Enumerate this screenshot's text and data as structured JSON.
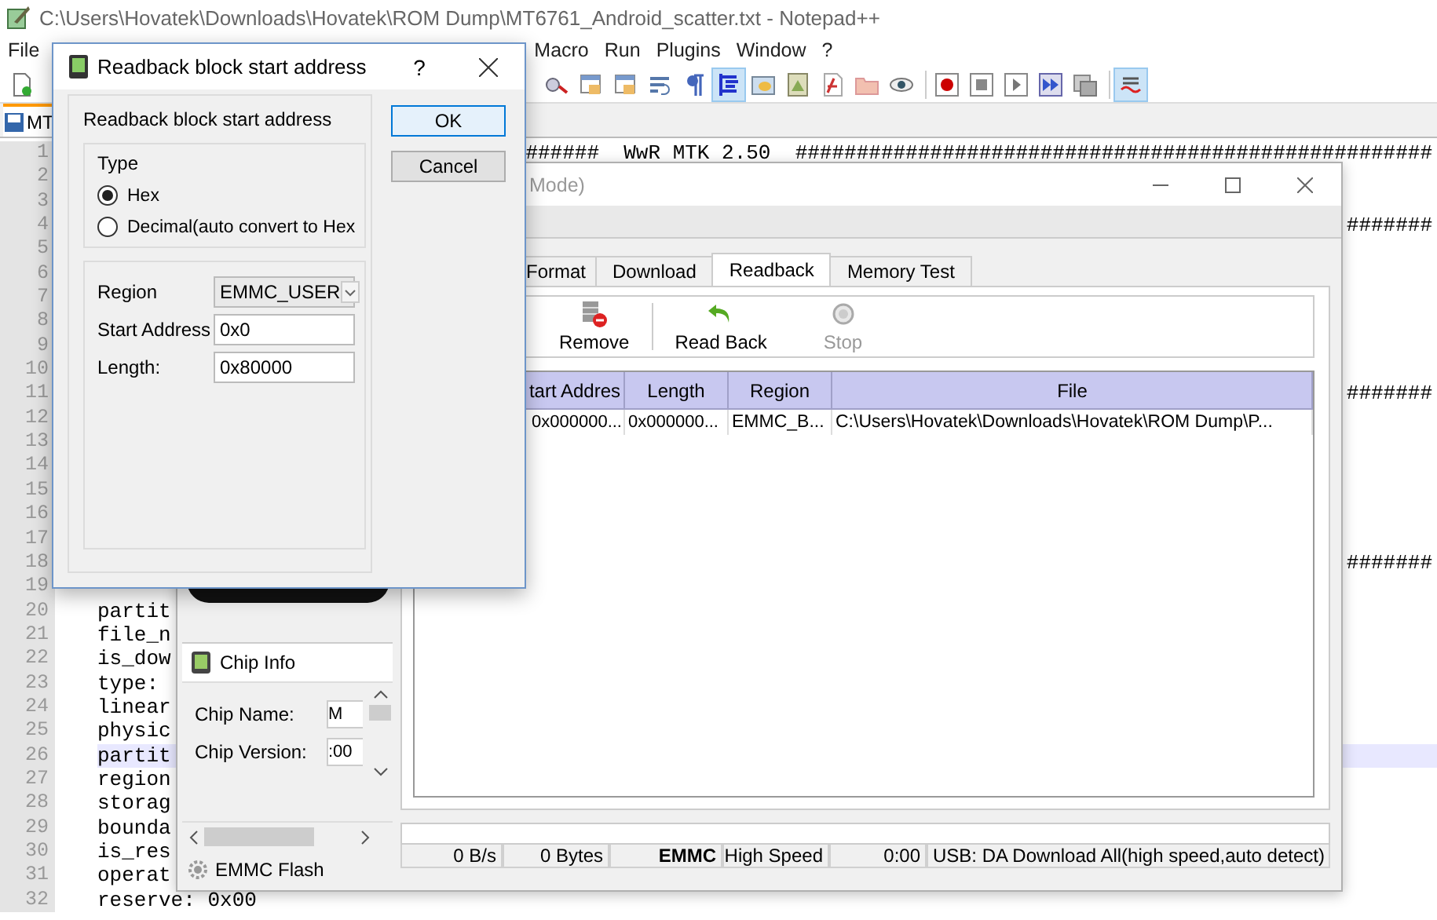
{
  "notepad": {
    "title": "C:\\Users\\Hovatek\\Downloads\\Hovatek\\ROM Dump\\MT6761_Android_scatter.txt - Notepad++",
    "menu": [
      "File",
      "Macro",
      "Run",
      "Plugins",
      "Window",
      "?"
    ],
    "tab": "MT",
    "lines": [
      {
        "number": "1",
        "text": "######  WwR MTK 2.50  ####################################################",
        "kind": "tail",
        "current": false
      },
      {
        "number": "2",
        "current": false
      },
      {
        "number": "3",
        "current": false
      },
      {
        "number": "4",
        "text": "#######",
        "kind": "tail",
        "current": false
      },
      {
        "number": "5",
        "current": false
      },
      {
        "number": "6",
        "current": false
      },
      {
        "number": "7",
        "current": false
      },
      {
        "number": "8",
        "current": false
      },
      {
        "number": "9",
        "current": false
      },
      {
        "number": "10",
        "current": false
      },
      {
        "number": "11",
        "text": "#######",
        "kind": "tail",
        "current": false
      },
      {
        "number": "12",
        "current": false
      },
      {
        "number": "13",
        "current": false
      },
      {
        "number": "14",
        "current": false
      },
      {
        "number": "15",
        "current": false
      },
      {
        "number": "16",
        "current": false
      },
      {
        "number": "17",
        "current": false
      },
      {
        "number": "18",
        "text": "#######",
        "kind": "tail",
        "current": false
      },
      {
        "number": "19",
        "current": false
      },
      {
        "number": "20",
        "text": "partit",
        "kind": "head",
        "current": false
      },
      {
        "number": "21",
        "text": "file_n",
        "kind": "head",
        "current": false
      },
      {
        "number": "22",
        "text": "is_dow",
        "kind": "head",
        "current": false
      },
      {
        "number": "23",
        "text": "type:",
        "kind": "head",
        "current": false
      },
      {
        "number": "24",
        "text": "linear",
        "kind": "head",
        "current": false
      },
      {
        "number": "25",
        "text": "physic",
        "kind": "head",
        "current": false
      },
      {
        "number": "26",
        "text": "partit",
        "kind": "head",
        "current": true
      },
      {
        "number": "27",
        "text": "region",
        "kind": "head",
        "current": false
      },
      {
        "number": "28",
        "text": "storag",
        "kind": "head",
        "current": false
      },
      {
        "number": "29",
        "text": "bounda",
        "kind": "head",
        "current": false
      },
      {
        "number": "30",
        "text": "is_res",
        "kind": "head",
        "current": false
      },
      {
        "number": "31",
        "text": "operat",
        "kind": "head",
        "current": false
      },
      {
        "number": "32",
        "text": "reserve: 0x00",
        "kind": "head",
        "current": false
      }
    ]
  },
  "flash_tool": {
    "title": "Mode)",
    "tabs": [
      {
        "label": "Format",
        "selected": false
      },
      {
        "label": "Download",
        "selected": false
      },
      {
        "label": "Readback",
        "selected": true
      },
      {
        "label": "Memory Test",
        "selected": false
      }
    ],
    "toolbar": [
      {
        "label": "Remove",
        "kind": "remove",
        "disabled": false
      },
      {
        "label": "Read Back",
        "kind": "readback",
        "disabled": false
      },
      {
        "label": "Stop",
        "kind": "stop",
        "disabled": true
      }
    ],
    "progress": {
      "level": 0
    },
    "table": {
      "columns": [
        "tart Addres",
        "Length",
        "Region",
        "File"
      ],
      "rows": [
        [
          "0x000000...",
          "0x000000...",
          "EMMC_B...",
          "C:\\Users\\Hovatek\\Downloads\\Hovatek\\ROM Dump\\P..."
        ]
      ]
    },
    "chip_info": {
      "title": "Chip Info",
      "fields": [
        {
          "label": "Chip Name:",
          "value": "M"
        },
        {
          "label": "Chip Version:",
          "value": ":00"
        }
      ],
      "storage": "EMMC Flash"
    },
    "status_bar": [
      {
        "text": "0 B/s",
        "bold": false
      },
      {
        "text": "0 Bytes",
        "bold": false
      },
      {
        "text": "EMMC",
        "bold": true
      },
      {
        "text": "High Speed",
        "bold": false
      },
      {
        "text": "0:00",
        "bold": false
      },
      {
        "text": "USB: DA Download All(high speed,auto detect)",
        "bold": false
      }
    ]
  },
  "dialog": {
    "title": "Readback block start address",
    "help": "?",
    "group_label": "Readback block start address",
    "type_label": "Type",
    "options": [
      {
        "label": "Hex",
        "selected": true
      },
      {
        "label": "Decimal(auto convert to Hex",
        "selected": false
      }
    ],
    "region": {
      "label": "Region",
      "value": "EMMC_USER"
    },
    "start_address": {
      "label": "Start Address",
      "value": "0x0"
    },
    "length": {
      "label": "Length:",
      "value": "0x80000"
    },
    "buttons": [
      {
        "label": "OK",
        "default": true
      },
      {
        "label": "Cancel",
        "default": false
      }
    ]
  }
}
